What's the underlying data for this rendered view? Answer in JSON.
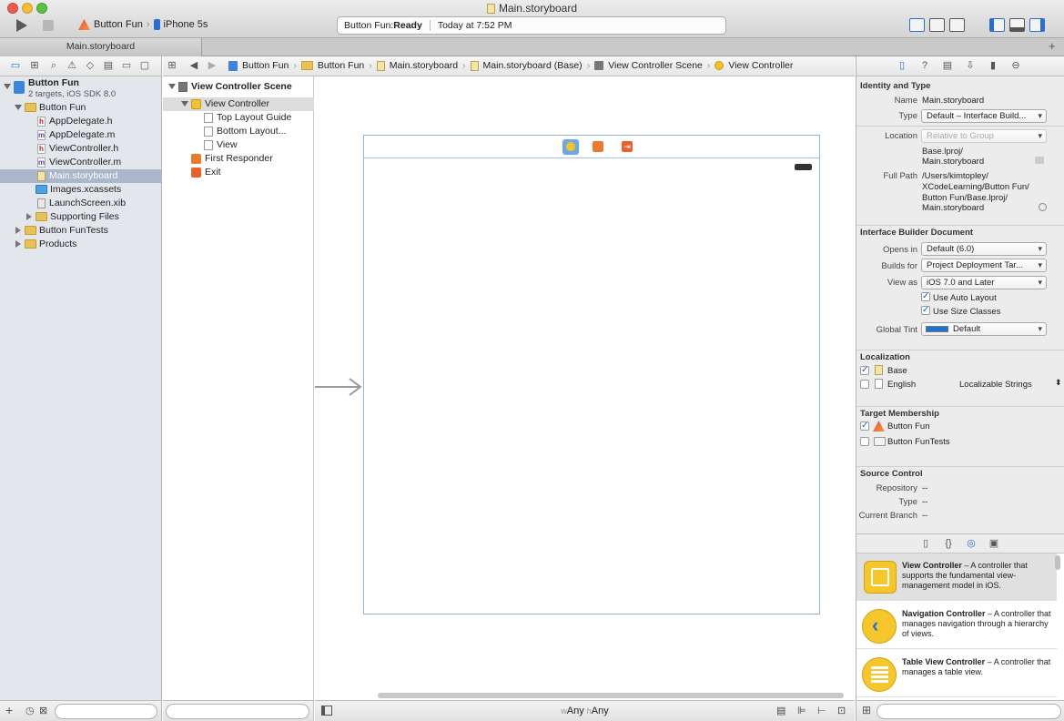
{
  "window": {
    "title": "Main.storyboard",
    "tab": "Main.storyboard"
  },
  "toolbar": {
    "scheme_name": "Button Fun",
    "device": "iPhone 5s",
    "status_app": "Button Fun: ",
    "status_state": "Ready",
    "status_time": "Today at 7:52 PM"
  },
  "jumpbar": {
    "items": [
      "Button Fun",
      "Button Fun",
      "Main.storyboard",
      "Main.storyboard (Base)",
      "View Controller Scene",
      "View Controller"
    ]
  },
  "navigator": {
    "project_name": "Button Fun",
    "project_sub": "2 targets, iOS SDK 8.0",
    "items": [
      {
        "label": "Button Fun",
        "type": "folder"
      },
      {
        "label": "AppDelegate.h",
        "type": "h"
      },
      {
        "label": "AppDelegate.m",
        "type": "m"
      },
      {
        "label": "ViewController.h",
        "type": "h"
      },
      {
        "label": "ViewController.m",
        "type": "m"
      },
      {
        "label": "Main.storyboard",
        "type": "storyboard",
        "selected": true
      },
      {
        "label": "Images.xcassets",
        "type": "assets"
      },
      {
        "label": "LaunchScreen.xib",
        "type": "xib"
      },
      {
        "label": "Supporting Files",
        "type": "folder"
      },
      {
        "label": "Button FunTests",
        "type": "folder"
      },
      {
        "label": "Products",
        "type": "folder"
      }
    ]
  },
  "outline": {
    "scene": "View Controller Scene",
    "items": [
      "View Controller",
      "Top Layout Guide",
      "Bottom Layout...",
      "View",
      "First Responder",
      "Exit"
    ]
  },
  "canvas": {
    "size_class_w": "w",
    "size_class_w_val": "Any",
    "size_class_h": "h",
    "size_class_h_val": "Any"
  },
  "inspector": {
    "identity_title": "Identity and Type",
    "name_label": "Name",
    "name_value": "Main.storyboard",
    "type_label": "Type",
    "type_value": "Default – Interface Build...",
    "location_label": "Location",
    "location_value": "Relative to Group",
    "location_path": [
      "Base.lproj/",
      "Main.storyboard"
    ],
    "fullpath_label": "Full Path",
    "fullpath_value": [
      "/Users/kimtopley/",
      "XCodeLearning/Button Fun/",
      "Button Fun/Base.lproj/",
      "Main.storyboard"
    ],
    "ibdoc_title": "Interface Builder Document",
    "opens_in_label": "Opens in",
    "opens_in_value": "Default (6.0)",
    "builds_for_label": "Builds for",
    "builds_for_value": "Project Deployment Tar...",
    "view_as_label": "View as",
    "view_as_value": "iOS 7.0 and Later",
    "auto_layout": "Use Auto Layout",
    "size_classes": "Use Size Classes",
    "global_tint_label": "Global Tint",
    "global_tint_value": "Default",
    "global_tint_color": "#1b74d6",
    "localization_title": "Localization",
    "loc_base": "Base",
    "loc_english": "English",
    "loc_english_value": "Localizable Strings",
    "target_title": "Target Membership",
    "target_1": "Button Fun",
    "target_2": "Button FunTests",
    "source_title": "Source Control",
    "repo_label": "Repository",
    "repo_value": "--",
    "sc_type_label": "Type",
    "sc_type_value": "--",
    "branch_label": "Current Branch",
    "branch_value": "--"
  },
  "library": {
    "items": [
      {
        "name": "View Controller",
        "desc": " – A controller that supports the fundamental view-management model in iOS."
      },
      {
        "name": "Navigation Controller",
        "desc": " – A controller that manages navigation through a hierarchy of views."
      },
      {
        "name": "Table View Controller",
        "desc": " – A controller that manages a table view."
      }
    ]
  },
  "colors": {
    "selection": "#aab6c9",
    "accent": "#2a6fd0",
    "vc_yellow": "#f2c230"
  }
}
